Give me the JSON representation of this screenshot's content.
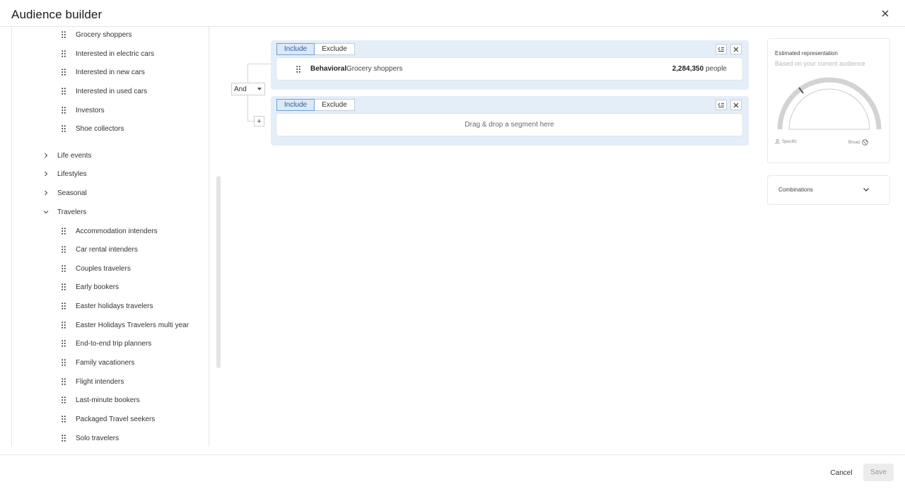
{
  "header": {
    "title": "Audience builder"
  },
  "tree": {
    "leaves_top": [
      "Grocery shoppers",
      "Interested in electric cars",
      "Interested in new cars",
      "Interested in used cars",
      "Investors",
      "Shoe collectors"
    ],
    "categories": [
      {
        "label": "Life events",
        "expanded": false
      },
      {
        "label": "Lifestyles",
        "expanded": false
      },
      {
        "label": "Seasonal",
        "expanded": false
      },
      {
        "label": "Travelers",
        "expanded": true
      }
    ],
    "travelers_children": [
      "Accommodation intenders",
      "Car rental intenders",
      "Couples travelers",
      "Early bookers",
      "Easter holidays travelers",
      "Easter Holidays Travelers multi year",
      "End-to-end trip planners",
      "Family vacationers",
      "Flight intenders",
      "Last-minute bookers",
      "Packaged Travel seekers",
      "Solo travelers"
    ]
  },
  "builder": {
    "operator": "And",
    "add_label": "+",
    "groups": [
      {
        "include_label": "Include",
        "exclude_label": "Exclude",
        "selected": "include",
        "segment": {
          "type": "Behavioral",
          "name": "Grocery shoppers",
          "count": "2,284,350",
          "unit": "people"
        }
      },
      {
        "include_label": "Include",
        "exclude_label": "Exclude",
        "selected": "include",
        "placeholder": "Drag & drop a segment here"
      }
    ]
  },
  "estimate": {
    "title": "Estimated representation",
    "subtitle": "Based on your current audience",
    "left_label": "Specific",
    "right_label": "Broad",
    "gauge_level": 0.3
  },
  "combinations": {
    "label": "Combinations"
  },
  "footer": {
    "cancel": "Cancel",
    "save": "Save"
  },
  "colors": {
    "group_bg": "#e4eef9",
    "include_active": "#dce9f8",
    "accent": "#2d5f9d",
    "gauge_track": "#d3d3d3",
    "gauge_needle": "#555555"
  }
}
